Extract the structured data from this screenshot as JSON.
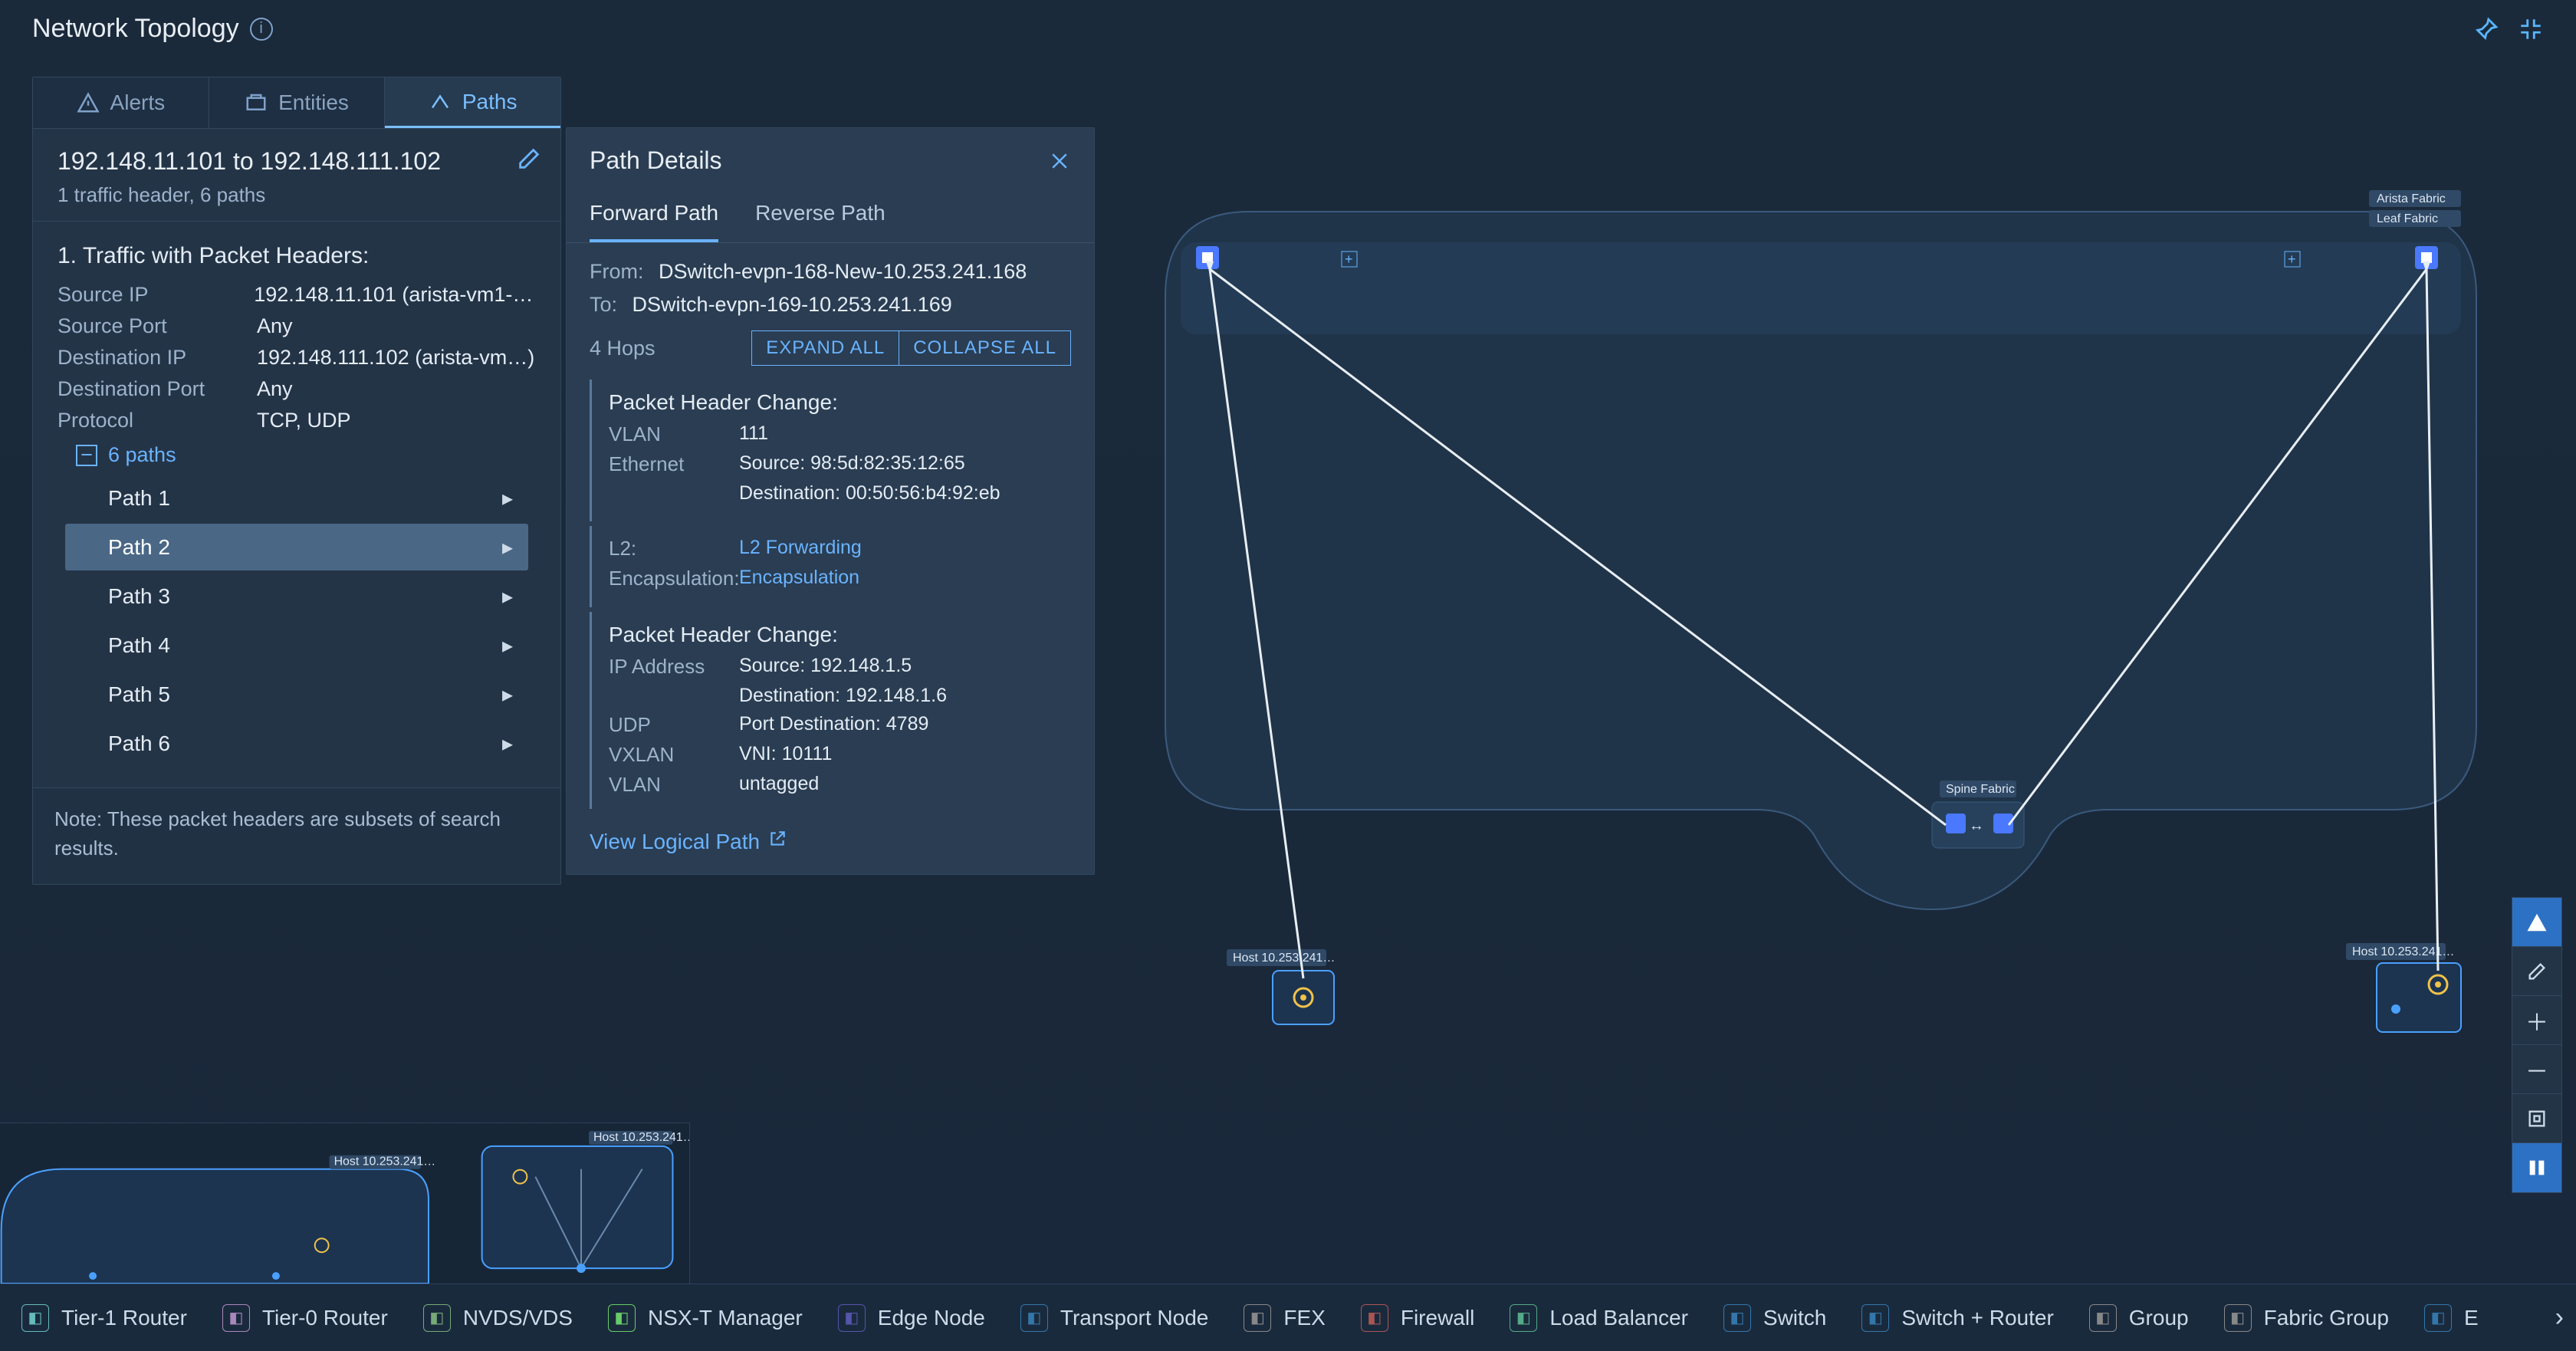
{
  "title": "Network Topology",
  "tabs": {
    "alerts": "Alerts",
    "entities": "Entities",
    "paths": "Paths"
  },
  "ip": {
    "line": "192.148.11.101 to 192.148.111.102",
    "sub": "1 traffic header, 6 paths"
  },
  "traffic": {
    "title": "1. Traffic with Packet Headers:",
    "rows": [
      {
        "k": "Source IP",
        "v": "192.148.11.101 (arista-vm1-…)"
      },
      {
        "k": "Source Port",
        "v": "Any"
      },
      {
        "k": "Destination IP",
        "v": "192.148.111.102 (arista-vm…)"
      },
      {
        "k": "Destination Port",
        "v": "Any"
      },
      {
        "k": "Protocol",
        "v": "TCP, UDP"
      }
    ],
    "paths_label": "6 paths",
    "paths": [
      "Path 1",
      "Path 2",
      "Path 3",
      "Path 4",
      "Path 5",
      "Path 6"
    ],
    "selected": 1
  },
  "note": "Note: These packet headers are subsets of search results.",
  "details": {
    "title": "Path Details",
    "subtabs": {
      "fwd": "Forward Path",
      "rev": "Reverse Path"
    },
    "from_lbl": "From:",
    "from": "DSwitch-evpn-168-New-10.253.241.168",
    "to_lbl": "To:",
    "to": "DSwitch-evpn-169-10.253.241.169",
    "hops": "4 Hops",
    "expand": "EXPAND ALL",
    "collapse": "COLLAPSE ALL",
    "view_lp": "View Logical Path",
    "blocks": [
      {
        "title": "Packet Header Change:",
        "rows": [
          {
            "k": "VLAN",
            "v": "111"
          },
          {
            "k": "Ethernet",
            "v": "Source: 98:5d:82:35:12:65"
          },
          {
            "k": "",
            "v": "Destination: 00:50:56:b4:92:eb"
          }
        ]
      },
      {
        "rows": [
          {
            "k": "L2:",
            "v": "L2 Forwarding",
            "link": true
          },
          {
            "k": "Encapsulation:",
            "v": "Encapsulation",
            "link": true
          }
        ]
      },
      {
        "title": "Packet Header Change:",
        "rows": [
          {
            "k": "IP Address",
            "v": "Source: 192.148.1.5"
          },
          {
            "k": "",
            "v": "Destination: 192.148.1.6"
          },
          {
            "k": "UDP",
            "v": "Port Destination: 4789"
          },
          {
            "k": "VXLAN",
            "v": "VNI: 10111"
          },
          {
            "k": "VLAN",
            "v": "untagged"
          }
        ]
      }
    ]
  },
  "legend": [
    "Tier-1 Router",
    "Tier-0 Router",
    "NVDS/VDS",
    "NSX-T Manager",
    "Edge Node",
    "Transport Node",
    "FEX",
    "Firewall",
    "Load Balancer",
    "Switch",
    "Switch + Router",
    "Group",
    "Fabric Group",
    "E"
  ],
  "topo_labels": {
    "arista": "Arista Fabric",
    "leaf": "Leaf Fabric",
    "spine": "Spine Fabric",
    "host1": "Host 10.253.241…",
    "host2": "Host 10.253.241…"
  }
}
